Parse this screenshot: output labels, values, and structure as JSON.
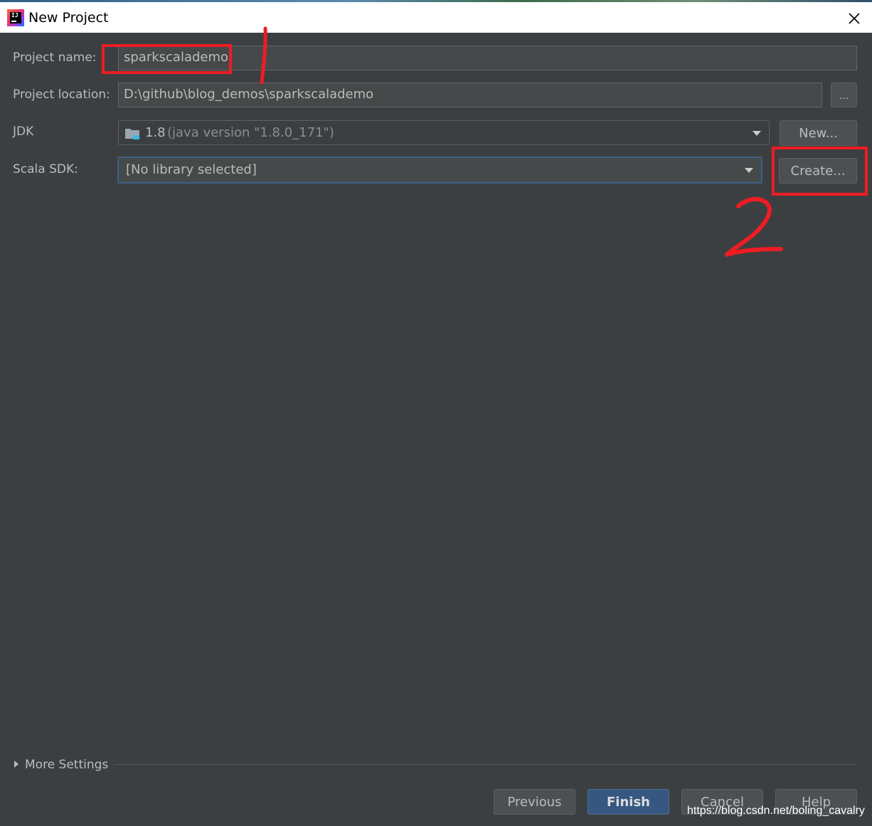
{
  "window": {
    "title": "New Project",
    "close_icon": "close-icon"
  },
  "form": {
    "project_name": {
      "label": "Project name:",
      "value": "sparkscalademo"
    },
    "project_location": {
      "label": "Project location:",
      "value": "D:\\github\\blog_demos\\sparkscalademo",
      "browse_label": "..."
    },
    "jdk": {
      "label": "JDK",
      "version": "1.8",
      "detail": "(java version \"1.8.0_171\")",
      "icon": "folder-icon",
      "new_label": "New..."
    },
    "scala_sdk": {
      "label": "Scala SDK:",
      "value": "[No library selected]",
      "create_label": "Create..."
    }
  },
  "more_settings": {
    "label": "More Settings"
  },
  "footer": {
    "previous_label": "Previous",
    "finish_label": "Finish",
    "cancel_label": "Cancel",
    "help_label": "Help"
  },
  "annotations": {
    "mark_1": "1",
    "mark_2": "2",
    "color": "#ee1c24"
  },
  "watermark": "https://blog.csdn.net/boling_cavalry",
  "colors": {
    "background": "#3c3f41",
    "field_background": "#45494a",
    "text": "#bbbbbb",
    "default_button": "#365880",
    "focus_border": "#3d6185"
  }
}
